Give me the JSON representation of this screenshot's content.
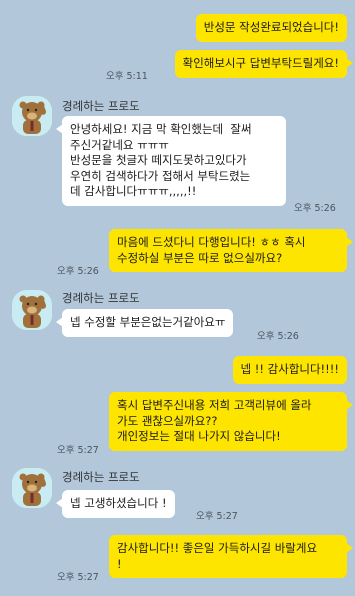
{
  "sender_name": "경례하는 프로도",
  "messages": [
    {
      "from": "me",
      "text": "반성문 작성완료되었습니다!",
      "time": ""
    },
    {
      "from": "me",
      "text": "확인해보시구 답변부탁드릴게요!",
      "time": "오후 5:11"
    },
    {
      "from": "other",
      "text": "안녕하세요! 지금 막 확인했는데  잘써\n주신거같네요 ㅠㅠㅠ\n반성문을 첫글자 떼지도못하고있다가\n우연히 검색하다가 접해서 부탁드렸는\n데 감사합니다ㅠㅠㅠ,,,,,!!",
      "time": "오후 5:26"
    },
    {
      "from": "me",
      "text": "마음에 드셨다니 다행입니다! ㅎㅎ 혹시\n수정하실 부분은 따로 없으실까요?",
      "time": "오후 5:26"
    },
    {
      "from": "other",
      "text": "넵 수정할 부분은없는거같아요ㅠ",
      "time": "오후 5:26"
    },
    {
      "from": "me",
      "text": "넵 !! 감사합니다!!!!",
      "time": ""
    },
    {
      "from": "me",
      "text": "혹시 답변주신내용 저희 고객리뷰에 올라\n가도 괜찮으실까요??\n개인정보는 절대 나가지 않습니다!",
      "time": "오후 5:27"
    },
    {
      "from": "other",
      "text": "넵 고생하셨습니다 !",
      "time": "오후 5:27"
    },
    {
      "from": "me",
      "text": "감사합니다!! 좋은일 가득하시길 바랄게요\n!",
      "time": "오후 5:27"
    }
  ],
  "colors": {
    "background": "#b2c7d9",
    "my_bubble": "#fee500",
    "other_bubble": "#ffffff"
  },
  "icons": {
    "avatar": "frodo-salute-avatar-icon"
  }
}
